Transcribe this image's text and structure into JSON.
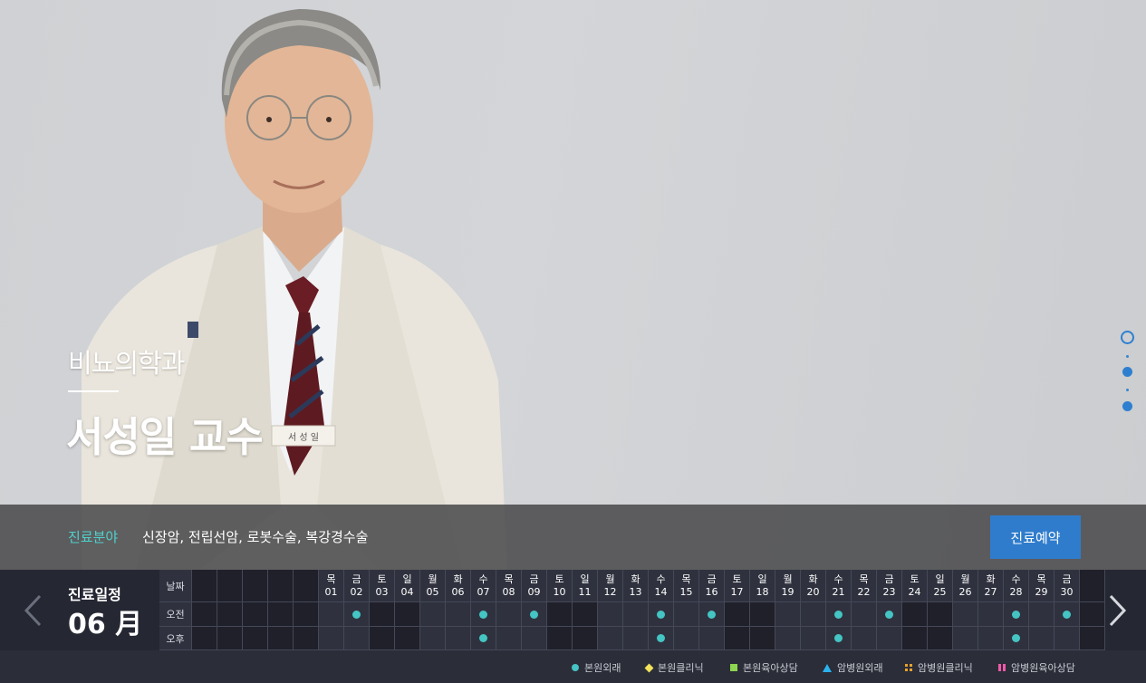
{
  "hero": {
    "department": "비뇨의학과",
    "doctor_name": "서성일 교수",
    "specialty_label": "진료분야",
    "specialty_text": "신장암, 전립선암, 로봇수술, 복강경수술",
    "reserve_label": "진료예약",
    "badge_name": "서 성 일",
    "slides": {
      "count": 3,
      "active": 0
    }
  },
  "colors": {
    "accent": "#2f7ccc",
    "specialty": "#4fd0cc",
    "clinic_dot": "#45c4c4"
  },
  "schedule": {
    "title": "진료일정",
    "month": "06 月",
    "row_labels": {
      "date": "날짜",
      "am": "오전",
      "pm": "오후"
    },
    "leading_blank_columns": 5,
    "trailing_blank_columns": 1,
    "days": [
      {
        "wd": "목",
        "d": "01",
        "am": false,
        "pm": false
      },
      {
        "wd": "금",
        "d": "02",
        "am": true,
        "pm": false
      },
      {
        "wd": "토",
        "d": "03",
        "am": false,
        "pm": false,
        "off": true
      },
      {
        "wd": "일",
        "d": "04",
        "am": false,
        "pm": false,
        "off": true
      },
      {
        "wd": "월",
        "d": "05",
        "am": false,
        "pm": false
      },
      {
        "wd": "화",
        "d": "06",
        "am": false,
        "pm": false
      },
      {
        "wd": "수",
        "d": "07",
        "am": true,
        "pm": true
      },
      {
        "wd": "목",
        "d": "08",
        "am": false,
        "pm": false
      },
      {
        "wd": "금",
        "d": "09",
        "am": true,
        "pm": false
      },
      {
        "wd": "토",
        "d": "10",
        "am": false,
        "pm": false,
        "off": true
      },
      {
        "wd": "일",
        "d": "11",
        "am": false,
        "pm": false,
        "off": true
      },
      {
        "wd": "월",
        "d": "12",
        "am": false,
        "pm": false
      },
      {
        "wd": "화",
        "d": "13",
        "am": false,
        "pm": false
      },
      {
        "wd": "수",
        "d": "14",
        "am": true,
        "pm": true
      },
      {
        "wd": "목",
        "d": "15",
        "am": false,
        "pm": false
      },
      {
        "wd": "금",
        "d": "16",
        "am": true,
        "pm": false
      },
      {
        "wd": "토",
        "d": "17",
        "am": false,
        "pm": false,
        "off": true
      },
      {
        "wd": "일",
        "d": "18",
        "am": false,
        "pm": false,
        "off": true
      },
      {
        "wd": "월",
        "d": "19",
        "am": false,
        "pm": false
      },
      {
        "wd": "화",
        "d": "20",
        "am": false,
        "pm": false
      },
      {
        "wd": "수",
        "d": "21",
        "am": true,
        "pm": true
      },
      {
        "wd": "목",
        "d": "22",
        "am": false,
        "pm": false
      },
      {
        "wd": "금",
        "d": "23",
        "am": true,
        "pm": false
      },
      {
        "wd": "토",
        "d": "24",
        "am": false,
        "pm": false,
        "off": true
      },
      {
        "wd": "일",
        "d": "25",
        "am": false,
        "pm": false,
        "off": true
      },
      {
        "wd": "월",
        "d": "26",
        "am": false,
        "pm": false
      },
      {
        "wd": "화",
        "d": "27",
        "am": false,
        "pm": false
      },
      {
        "wd": "수",
        "d": "28",
        "am": true,
        "pm": true
      },
      {
        "wd": "목",
        "d": "29",
        "am": false,
        "pm": false
      },
      {
        "wd": "금",
        "d": "30",
        "am": true,
        "pm": false
      }
    ],
    "legend": [
      {
        "marker": "circle",
        "label": "본원외래"
      },
      {
        "marker": "diamond",
        "label": "본원클리닉"
      },
      {
        "marker": "square",
        "label": "본원육아상담"
      },
      {
        "marker": "tri",
        "label": "암병원외래"
      },
      {
        "marker": "quad",
        "label": "암병원클리닉"
      },
      {
        "marker": "bars",
        "label": "암병원육아상담"
      }
    ]
  }
}
